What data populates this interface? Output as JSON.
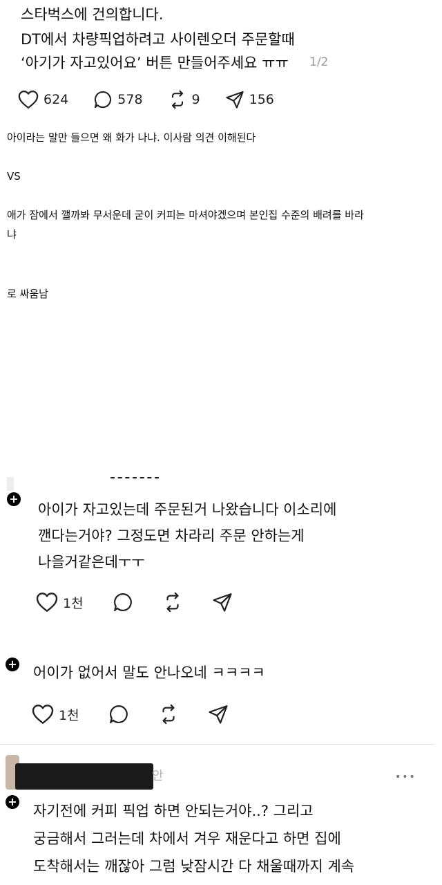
{
  "post": {
    "lines": [
      "스타벅스에 건의합니다.",
      "DT에서 차량픽업하려고 사이렌오더 주문할때",
      "‘아기가 자고있어요’ 버튼 만들어주세요 ㅠㅠ"
    ],
    "page_indicator": "1/2",
    "actions": {
      "likes": "624",
      "comments": "578",
      "reposts": "9",
      "shares": "156"
    }
  },
  "caption": {
    "line1": "아이라는 말만 들으면 왜 화가 나냐. 이사람 의견 이해된다",
    "vs": "VS",
    "line2": "애가 잠에서 깰까봐 무서운데 굳이 커피는 마셔야겠으며 본인집 수준의 배려를 바라",
    "line2b": "냐",
    "line3": "로 싸움남"
  },
  "comments": [
    {
      "lines": [
        "아이가 자고있는데 주문된거 나왔습니다 이소리에",
        "깬다는거야? 그정도면 차라리 주문 안하는게",
        "나을거같은데ㅜㅜ"
      ],
      "likes": "1천"
    },
    {
      "lines": [
        "어이가 없어서 말도 안나오네 ㅋㅋㅋㅋ"
      ],
      "likes": "1천"
    },
    {
      "lines": [
        "자기전에 커피 픽업 하면 안되는거야..? 그리고",
        "궁금해서 그러는데 차에서 겨우 재운다고 하면 집에",
        "도착해서는 깨잖아 그럼 낮잠시간 다 채울때까지 계속"
      ],
      "partial_name_char": "안",
      "more": "•••"
    }
  ]
}
